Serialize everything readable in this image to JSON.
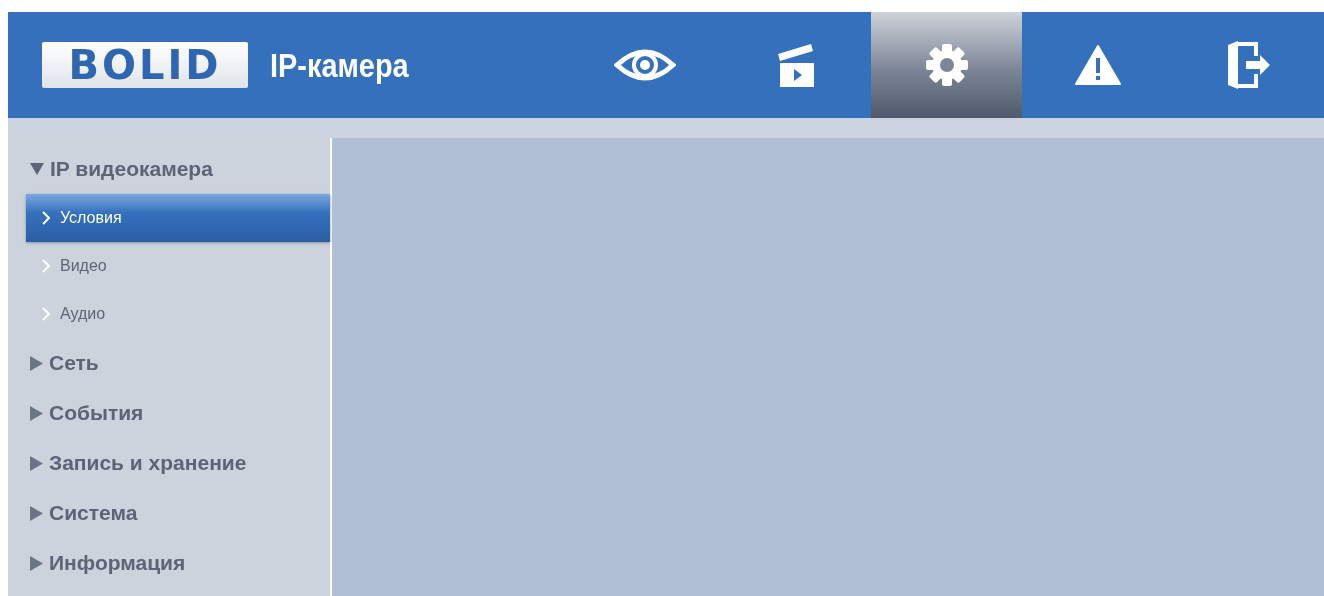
{
  "header": {
    "logo": "BOLID",
    "title": "IP-камера"
  },
  "tabs": [
    {
      "kind": "eye",
      "selected": false
    },
    {
      "kind": "clapper",
      "selected": false
    },
    {
      "kind": "gear",
      "selected": true
    },
    {
      "kind": "warning",
      "selected": false
    },
    {
      "kind": "exit",
      "selected": false
    }
  ],
  "sidebar": {
    "items": [
      {
        "label": "IP видеокамера",
        "expanded": true,
        "children": [
          {
            "label": "Условия",
            "selected": true
          },
          {
            "label": "Видео",
            "selected": false
          },
          {
            "label": "Аудио",
            "selected": false
          }
        ]
      },
      {
        "label": "Сеть",
        "expanded": false
      },
      {
        "label": "События",
        "expanded": false
      },
      {
        "label": "Запись и хранение",
        "expanded": false
      },
      {
        "label": "Система",
        "expanded": false
      },
      {
        "label": "Информация",
        "expanded": false
      }
    ]
  }
}
